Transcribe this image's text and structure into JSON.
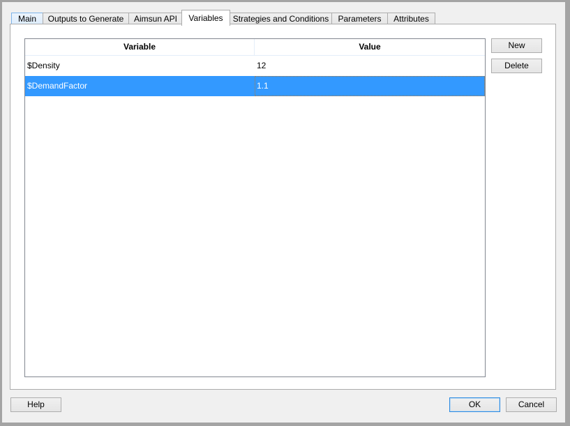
{
  "tabs": [
    {
      "label": "Main",
      "state": "hover"
    },
    {
      "label": "Outputs to Generate",
      "state": "normal"
    },
    {
      "label": "Aimsun API",
      "state": "normal"
    },
    {
      "label": "Variables",
      "state": "active"
    },
    {
      "label": "Strategies and Conditions",
      "state": "normal"
    },
    {
      "label": "Parameters",
      "state": "normal"
    },
    {
      "label": "Attributes",
      "state": "normal"
    }
  ],
  "variables_table": {
    "columns": [
      "Variable",
      "Value"
    ],
    "rows": [
      {
        "variable": "$Density",
        "value": "12",
        "selected": false
      },
      {
        "variable": "$DemandFactor",
        "value": "1.1",
        "selected": true
      }
    ]
  },
  "side_buttons": {
    "new_label": "New",
    "delete_label": "Delete"
  },
  "footer": {
    "help_label": "Help",
    "ok_label": "OK",
    "cancel_label": "Cancel"
  },
  "colors": {
    "selection": "#3399ff",
    "window_bg": "#f0f0f0",
    "frame": "#a4a4a4"
  }
}
